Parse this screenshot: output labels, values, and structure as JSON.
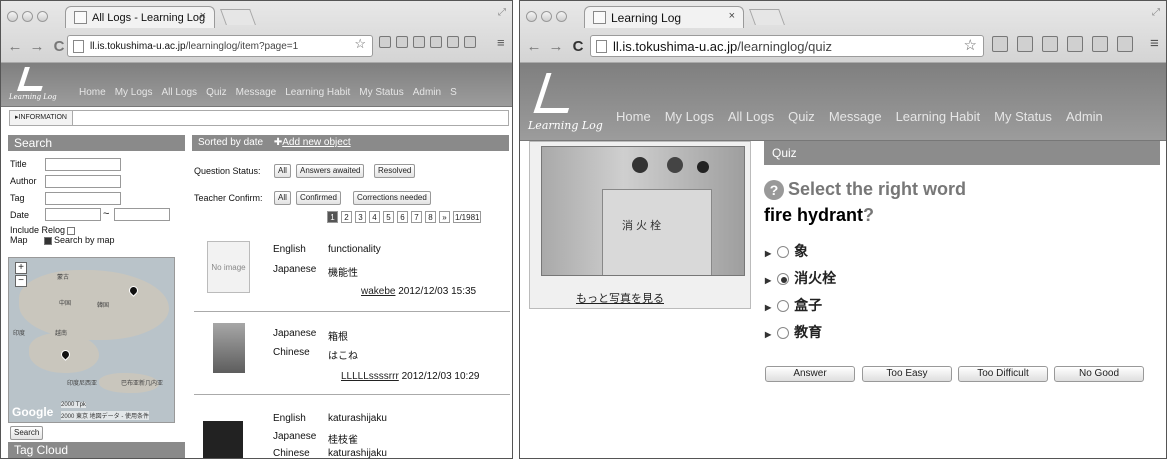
{
  "left": {
    "tab_title": "All Logs - Learning Log",
    "url_host": "ll.is.tokushima-u.ac.jp",
    "url_path": "/learninglog/item?page=1",
    "logo_text": "Learning Log",
    "nav": [
      "Home",
      "My Logs",
      "All Logs",
      "Quiz",
      "Message",
      "Learning Habit",
      "My Status",
      "Admin",
      "S"
    ],
    "info_button": "▸INFORMATION",
    "search": {
      "heading": "Search",
      "fields": [
        "Title",
        "Author",
        "Tag",
        "Date"
      ],
      "date_sep": "~",
      "include_relog": "Include Relog",
      "map_label": "Map",
      "search_by_map": "Search by map",
      "button": "Search",
      "map_labels": [
        "蒙古",
        "中国",
        "韓国",
        "印度",
        "越南",
        "印度尼西亚",
        "巴布亚新几内亚"
      ],
      "map_copyright": "2000 Tpk",
      "map_copyright2": "2000 東京 地図データ - 使用条件",
      "google": "Google"
    },
    "tag_cloud": "Tag Cloud",
    "list": {
      "sort_label": "Sorted by date",
      "add_new": "Add new object",
      "question_status_label": "Question Status:",
      "question_status": [
        "All",
        "Answers awaited",
        "Resolved"
      ],
      "teacher_confirm_label": "Teacher Confirm:",
      "teacher_confirm": [
        "All",
        "Confirmed",
        "Corrections needed"
      ],
      "pages": [
        "1",
        "2",
        "3",
        "4",
        "5",
        "6",
        "7",
        "8",
        "»",
        "1/1981"
      ],
      "items": [
        {
          "image": "No image",
          "rows": [
            {
              "lang": "English",
              "word": "functionality"
            },
            {
              "lang": "Japanese",
              "word": "機能性"
            }
          ],
          "author": "wakebe",
          "date": "2012/12/03 15:35"
        },
        {
          "image": "",
          "rows": [
            {
              "lang": "Japanese",
              "word": "箱根"
            },
            {
              "lang": "Chinese",
              "word": "はこね"
            }
          ],
          "author": "LLLLLssssrrr",
          "date": "2012/12/03 10:29"
        },
        {
          "image": "",
          "rows": [
            {
              "lang": "English",
              "word": "katurashijaku"
            },
            {
              "lang": "Japanese",
              "word": "桂枝雀"
            },
            {
              "lang": "Chinese",
              "word": "katurashijaku"
            }
          ],
          "author": "",
          "date": ""
        }
      ]
    }
  },
  "right": {
    "tab_title": "Learning Log",
    "url_host": "ll.is.tokushima-u.ac.jp",
    "url_path": "/learninglog/quiz",
    "logo_text": "Learning Log",
    "nav": [
      "Home",
      "My Logs",
      "All Logs",
      "Quiz",
      "Message",
      "Learning Habit",
      "My Status",
      "Admin"
    ],
    "photo_sign": "消 火 栓",
    "more_photos": "もっと写真を見る",
    "quiz": {
      "heading": "Quiz",
      "prompt": "Select the right word",
      "target": "fire hydrant",
      "qmark": "?",
      "options": [
        {
          "label": "象",
          "selected": false
        },
        {
          "label": "消火栓",
          "selected": true
        },
        {
          "label": "盒子",
          "selected": false
        },
        {
          "label": "教育",
          "selected": false
        }
      ],
      "buttons": [
        "Answer",
        "Too Easy",
        "Too Difficult",
        "No Good"
      ]
    }
  }
}
